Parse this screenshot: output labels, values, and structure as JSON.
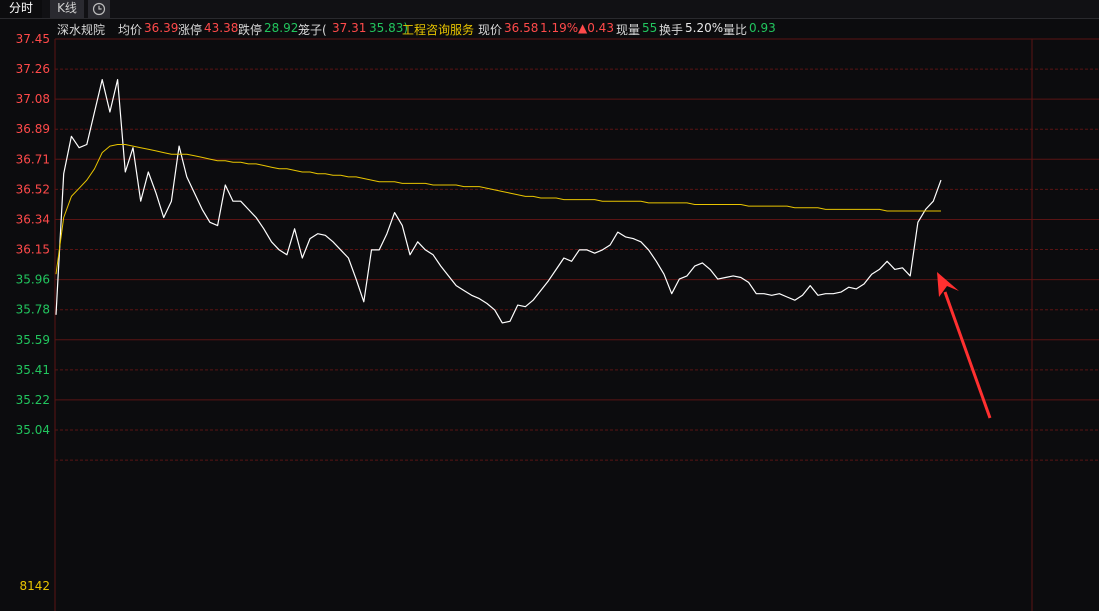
{
  "tabs": {
    "time": "分时",
    "kline": "K线"
  },
  "info": {
    "stock_name": "深水规院",
    "avg_label": "均价",
    "avg_value": "36.39",
    "limit_up_label": "涨停",
    "limit_up_value": "43.38",
    "limit_down_label": "跌停",
    "limit_down_value": "28.92",
    "cage_label": "笼子(",
    "cage_high": "37.31",
    "cage_low": "35.83)",
    "sector": "工程咨询服务",
    "price_label": "现价",
    "price_value": "36.58",
    "change_pct": "1.19%",
    "change_abs": "▲0.43",
    "cur_vol_label": "现量",
    "cur_vol_value": "55",
    "turnover_label": "换手",
    "turnover_value": "5.20%",
    "vol_ratio_label": "量比",
    "vol_ratio_value": "0.93"
  },
  "colors": {
    "up": "#ff4a4a",
    "down": "#22c55e",
    "avg_line": "#e8c400",
    "price_line": "#ffffff",
    "grid": "#5a1414",
    "arrow": "#ff3030"
  },
  "chart_data": {
    "type": "line",
    "x_label": "",
    "y_label": "",
    "ylim": [
      35.04,
      37.45
    ],
    "y_ticks": [
      "37.45",
      "37.26",
      "37.08",
      "36.89",
      "36.71",
      "36.52",
      "36.34",
      "36.15",
      "35.96",
      "35.78",
      "35.59",
      "35.41",
      "35.22",
      "35.04"
    ],
    "y_tick_colors": [
      "up",
      "up",
      "up",
      "up",
      "up",
      "up",
      "up",
      "up",
      "down",
      "down",
      "down",
      "down",
      "down",
      "down"
    ],
    "volume_tick": "8142",
    "grid": true,
    "series": [
      {
        "id": "price",
        "color": "price_line",
        "values": [
          35.75,
          36.62,
          36.85,
          36.78,
          36.8,
          37.0,
          37.2,
          37.0,
          37.2,
          36.63,
          36.78,
          36.45,
          36.63,
          36.5,
          36.35,
          36.45,
          36.79,
          36.6,
          36.5,
          36.4,
          36.32,
          36.3,
          36.55,
          36.45,
          36.45,
          36.4,
          36.35,
          36.28,
          36.2,
          36.15,
          36.12,
          36.28,
          36.1,
          36.22,
          36.25,
          36.24,
          36.2,
          36.15,
          36.1,
          35.97,
          35.83,
          36.15,
          36.15,
          36.25,
          36.38,
          36.3,
          36.12,
          36.2,
          36.15,
          36.12,
          36.05,
          35.99,
          35.93,
          35.9,
          35.87,
          35.85,
          35.82,
          35.78,
          35.7,
          35.71,
          35.81,
          35.8,
          35.84,
          35.9,
          35.96,
          36.03,
          36.1,
          36.08,
          36.15,
          36.15,
          36.13,
          36.15,
          36.18,
          36.26,
          36.23,
          36.22,
          36.2,
          36.15,
          36.08,
          36.0,
          35.88,
          35.97,
          35.99,
          36.05,
          36.07,
          36.03,
          35.97,
          35.98,
          35.99,
          35.98,
          35.95,
          35.88,
          35.88,
          35.87,
          35.88,
          35.86,
          35.84,
          35.87,
          35.93,
          35.87,
          35.88,
          35.88,
          35.89,
          35.92,
          35.91,
          35.94,
          36.0,
          36.03,
          36.08,
          36.03,
          36.04,
          35.99,
          36.32,
          36.4,
          36.45,
          36.58
        ]
      },
      {
        "id": "average",
        "color": "avg_line",
        "values": [
          36.0,
          36.35,
          36.48,
          36.53,
          36.58,
          36.65,
          36.75,
          36.79,
          36.8,
          36.8,
          36.79,
          36.78,
          36.77,
          36.76,
          36.75,
          36.74,
          36.74,
          36.74,
          36.73,
          36.72,
          36.71,
          36.7,
          36.7,
          36.69,
          36.69,
          36.68,
          36.68,
          36.67,
          36.66,
          36.65,
          36.65,
          36.64,
          36.63,
          36.63,
          36.62,
          36.62,
          36.61,
          36.61,
          36.6,
          36.6,
          36.59,
          36.58,
          36.57,
          36.57,
          36.57,
          36.56,
          36.56,
          36.56,
          36.56,
          36.55,
          36.55,
          36.55,
          36.55,
          36.54,
          36.54,
          36.54,
          36.53,
          36.52,
          36.51,
          36.5,
          36.49,
          36.48,
          36.48,
          36.47,
          36.47,
          36.47,
          36.46,
          36.46,
          36.46,
          36.46,
          36.46,
          36.45,
          36.45,
          36.45,
          36.45,
          36.45,
          36.45,
          36.44,
          36.44,
          36.44,
          36.44,
          36.44,
          36.44,
          36.43,
          36.43,
          36.43,
          36.43,
          36.43,
          36.43,
          36.43,
          36.42,
          36.42,
          36.42,
          36.42,
          36.42,
          36.42,
          36.41,
          36.41,
          36.41,
          36.41,
          36.4,
          36.4,
          36.4,
          36.4,
          36.4,
          36.4,
          36.4,
          36.4,
          36.39,
          36.39,
          36.39,
          36.39,
          36.39,
          36.39,
          36.39,
          36.39
        ]
      }
    ]
  }
}
